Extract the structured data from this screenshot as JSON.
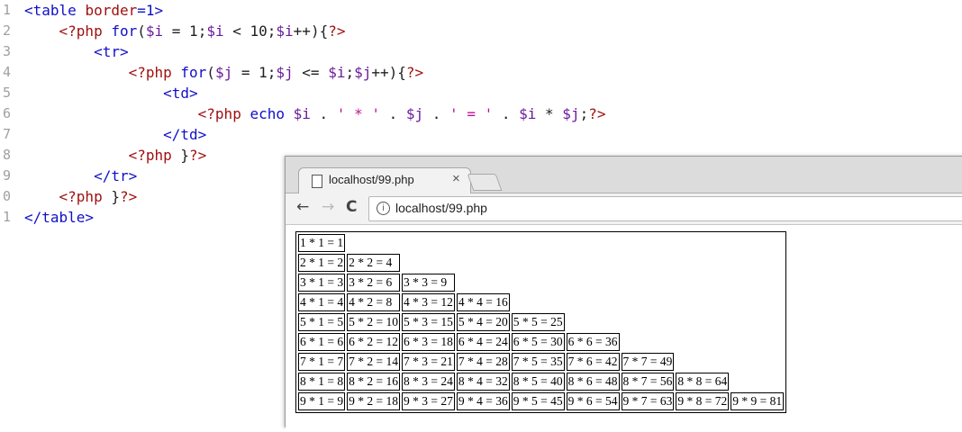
{
  "editor": {
    "line_numbers": [
      "1",
      "2",
      "3",
      "4",
      "5",
      "6",
      "7",
      "8",
      "9",
      "0",
      "1"
    ],
    "lines": [
      [
        [
          "tag",
          "<table "
        ],
        [
          "attr",
          "border"
        ],
        [
          "tag",
          "=1>"
        ]
      ],
      [
        [
          "op",
          "    "
        ],
        [
          "php",
          "<?php "
        ],
        [
          "kw",
          "for"
        ],
        [
          "op",
          "("
        ],
        [
          "var",
          "$i"
        ],
        [
          "op",
          " = "
        ],
        [
          "num",
          "1"
        ],
        [
          "op",
          ";"
        ],
        [
          "var",
          "$i"
        ],
        [
          "op",
          " < "
        ],
        [
          "num",
          "10"
        ],
        [
          "op",
          ";"
        ],
        [
          "var",
          "$i"
        ],
        [
          "op",
          "++){"
        ],
        [
          "php",
          "?>"
        ]
      ],
      [
        [
          "op",
          "        "
        ],
        [
          "tag",
          "<tr>"
        ]
      ],
      [
        [
          "op",
          "            "
        ],
        [
          "php",
          "<?php "
        ],
        [
          "kw",
          "for"
        ],
        [
          "op",
          "("
        ],
        [
          "var",
          "$j"
        ],
        [
          "op",
          " = "
        ],
        [
          "num",
          "1"
        ],
        [
          "op",
          ";"
        ],
        [
          "var",
          "$j"
        ],
        [
          "op",
          " <= "
        ],
        [
          "var",
          "$i"
        ],
        [
          "op",
          ";"
        ],
        [
          "var",
          "$j"
        ],
        [
          "op",
          "++){"
        ],
        [
          "php",
          "?>"
        ]
      ],
      [
        [
          "op",
          "                "
        ],
        [
          "tag",
          "<td>"
        ]
      ],
      [
        [
          "op",
          "                    "
        ],
        [
          "php",
          "<?php "
        ],
        [
          "kw",
          "echo "
        ],
        [
          "var",
          "$i"
        ],
        [
          "op",
          " . "
        ],
        [
          "str",
          "' * '"
        ],
        [
          "op",
          " . "
        ],
        [
          "var",
          "$j"
        ],
        [
          "op",
          " . "
        ],
        [
          "str",
          "' = '"
        ],
        [
          "op",
          " . "
        ],
        [
          "var",
          "$i"
        ],
        [
          "op",
          " * "
        ],
        [
          "var",
          "$j"
        ],
        [
          "op",
          ";"
        ],
        [
          "php",
          "?>"
        ]
      ],
      [
        [
          "op",
          "                "
        ],
        [
          "tag",
          "</td>"
        ]
      ],
      [
        [
          "op",
          "            "
        ],
        [
          "php",
          "<?php "
        ],
        [
          "op",
          "}"
        ],
        [
          "php",
          "?>"
        ]
      ],
      [
        [
          "op",
          "        "
        ],
        [
          "tag",
          "</tr>"
        ]
      ],
      [
        [
          "op",
          "    "
        ],
        [
          "php",
          "<?php "
        ],
        [
          "op",
          "}"
        ],
        [
          "php",
          "?>"
        ]
      ],
      [
        [
          "tag",
          "</table>"
        ]
      ]
    ]
  },
  "browser": {
    "tab_title": "localhost/99.php",
    "tab_close": "×",
    "back_icon": "←",
    "forward_icon": "→",
    "reload_icon": "C",
    "info_icon": "i",
    "url": "localhost/99.php"
  },
  "table": {
    "rows": [
      [
        "1 * 1 = 1"
      ],
      [
        "2 * 1 = 2",
        "2 * 2 = 4"
      ],
      [
        "3 * 1 = 3",
        "3 * 2 = 6",
        "3 * 3 = 9"
      ],
      [
        "4 * 1 = 4",
        "4 * 2 = 8",
        "4 * 3 = 12",
        "4 * 4 = 16"
      ],
      [
        "5 * 1 = 5",
        "5 * 2 = 10",
        "5 * 3 = 15",
        "5 * 4 = 20",
        "5 * 5 = 25"
      ],
      [
        "6 * 1 = 6",
        "6 * 2 = 12",
        "6 * 3 = 18",
        "6 * 4 = 24",
        "6 * 5 = 30",
        "6 * 6 = 36"
      ],
      [
        "7 * 1 = 7",
        "7 * 2 = 14",
        "7 * 3 = 21",
        "7 * 4 = 28",
        "7 * 5 = 35",
        "7 * 6 = 42",
        "7 * 7 = 49"
      ],
      [
        "8 * 1 = 8",
        "8 * 2 = 16",
        "8 * 3 = 24",
        "8 * 4 = 32",
        "8 * 5 = 40",
        "8 * 6 = 48",
        "8 * 7 = 56",
        "8 * 8 = 64"
      ],
      [
        "9 * 1 = 9",
        "9 * 2 = 18",
        "9 * 3 = 27",
        "9 * 4 = 36",
        "9 * 5 = 45",
        "9 * 6 = 54",
        "9 * 7 = 63",
        "9 * 8 = 72",
        "9 * 9 = 81"
      ]
    ]
  }
}
